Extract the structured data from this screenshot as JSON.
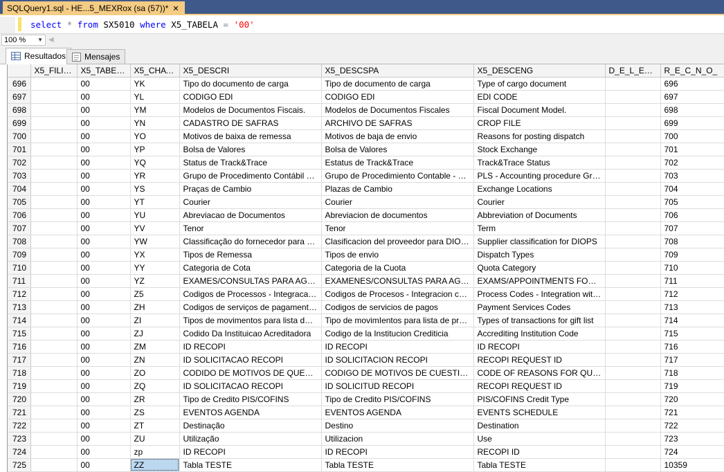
{
  "document_tab": {
    "title": "SQLQuery1.sql - HE...5_MEXRox (sa (57))*",
    "close_glyph": "✕"
  },
  "editor": {
    "tokens": [
      {
        "text": "select",
        "kind": "kw"
      },
      {
        "text": " ",
        "kind": "id"
      },
      {
        "text": "*",
        "kind": "op"
      },
      {
        "text": " ",
        "kind": "id"
      },
      {
        "text": "from",
        "kind": "kw"
      },
      {
        "text": " SX5010 ",
        "kind": "id"
      },
      {
        "text": "where",
        "kind": "kw"
      },
      {
        "text": " X5_TABELA ",
        "kind": "id"
      },
      {
        "text": "=",
        "kind": "op"
      },
      {
        "text": " ",
        "kind": "id"
      },
      {
        "text": "'00'",
        "kind": "str"
      }
    ]
  },
  "zoom": {
    "value": "100 %",
    "arrow": "▼",
    "scroll_left": "◀"
  },
  "results_tabs": {
    "results": "Resultados",
    "messages": "Mensajes"
  },
  "grid": {
    "columns": [
      "",
      "X5_FILIAL",
      "X5_TABELA",
      "X5_CHAVE",
      "X5_DESCRI",
      "X5_DESCSPA",
      "X5_DESCENG",
      "D_E_L_E_T_",
      "R_E_C_N_O_"
    ],
    "selected_row_index": 29,
    "selected_col_index": 3,
    "rows": [
      [
        "696",
        "",
        "00",
        "YK",
        "Tipo do documento de carga",
        "Tipo de documento de carga",
        "Type of cargo document",
        "",
        "696"
      ],
      [
        "697",
        "",
        "00",
        "YL",
        "CODIGO EDI",
        "CODIGO EDI",
        "EDI CODE",
        "",
        "697"
      ],
      [
        "698",
        "",
        "00",
        "YM",
        "Modelos de Documentos Fiscais.",
        "Modelos de Documentos Fiscales",
        "Fiscal Document Model.",
        "",
        "698"
      ],
      [
        "699",
        "",
        "00",
        "YN",
        "CADASTRO DE SAFRAS",
        "ARCHIVO DE SAFRAS",
        "CROP FILE",
        "",
        "699"
      ],
      [
        "700",
        "",
        "00",
        "YO",
        "Motivos de baixa de remessa",
        "Motivos de baja de envio",
        "Reasons for posting dispatch",
        "",
        "700"
      ],
      [
        "701",
        "",
        "00",
        "YP",
        "Bolsa de Valores",
        "Bolsa de Valores",
        "Stock Exchange",
        "",
        "701"
      ],
      [
        "702",
        "",
        "00",
        "YQ",
        "Status de Track&Trace",
        "Estatus de Track&Trace",
        "Track&Trace Status",
        "",
        "702"
      ],
      [
        "703",
        "",
        "00",
        "YR",
        "Grupo de Procedimento Contábil - PLS",
        "Grupo de Procedimiento Contable - PLS",
        "PLS - Accounting procedure Group",
        "",
        "703"
      ],
      [
        "704",
        "",
        "00",
        "YS",
        "Praças de Cambio",
        "Plazas de Cambio",
        "Exchange Locations",
        "",
        "704"
      ],
      [
        "705",
        "",
        "00",
        "YT",
        "Courier",
        "Courier",
        "Courier",
        "",
        "705"
      ],
      [
        "706",
        "",
        "00",
        "YU",
        "Abreviacao de Documentos",
        "Abreviacion de documentos",
        "Abbreviation of Documents",
        "",
        "706"
      ],
      [
        "707",
        "",
        "00",
        "YV",
        "Tenor",
        "Tenor",
        "Term",
        "",
        "707"
      ],
      [
        "708",
        "",
        "00",
        "YW",
        "Classificação do fornecedor para DIO...",
        "Clasificacion del proveedor para DIOPS",
        "Supplier classification for DIOPS",
        "",
        "708"
      ],
      [
        "709",
        "",
        "00",
        "YX",
        "Tipos de Remessa",
        "Tipos de envio",
        "Dispatch Types",
        "",
        "709"
      ],
      [
        "710",
        "",
        "00",
        "YY",
        "Categoria de Cota",
        "Categoria de la Cuota",
        "Quota Category",
        "",
        "710"
      ],
      [
        "711",
        "",
        "00",
        "YZ",
        "EXAMES/CONSULTAS PARA AGEN...",
        "EXAMENES/CONSULTAS PARA AGEN...",
        "EXAMS/APPOINTMENTS FOR SC...",
        "",
        "711"
      ],
      [
        "712",
        "",
        "00",
        "Z5",
        "Codigos de Processos - Integracao co...",
        "Codigos de Procesos - Integracion con Fi...",
        "Process Codes - Integration with Fin...",
        "",
        "712"
      ],
      [
        "713",
        "",
        "00",
        "ZH",
        "Codigos de serviços de pagamentos",
        "Codigos de servicios de pagos",
        "Payment Services Codes",
        "",
        "713"
      ],
      [
        "714",
        "",
        "00",
        "ZI",
        "Tipos de movimentos para lista de pre...",
        "Tipo de movimIentos para lista de present...",
        "Types of transactions for gift list",
        "",
        "714"
      ],
      [
        "715",
        "",
        "00",
        "ZJ",
        "Codido Da Instituicao Acreditadora",
        "Codigo de la Institucion Crediticia",
        "Accrediting Institution Code",
        "",
        "715"
      ],
      [
        "716",
        "",
        "00",
        "ZM",
        "ID RECOPI",
        "ID RECOPI",
        "ID RECOPI",
        "",
        "716"
      ],
      [
        "717",
        "",
        "00",
        "ZN",
        "ID SOLICITACAO RECOPI",
        "ID SOLICITACION RECOPI",
        "RECOPI REQUEST ID",
        "",
        "717"
      ],
      [
        "718",
        "",
        "00",
        "ZO",
        "CODIDO DE MOTIVOS DE QUESTIO...",
        "CODIGO DE MOTIVOS DE CUESTIONA...",
        "CODE OF REASONS FOR QUEST...",
        "",
        "718"
      ],
      [
        "719",
        "",
        "00",
        "ZQ",
        "ID SOLICITACAO RECOPI",
        "ID SOLICITUD RECOPI",
        "RECOPI REQUEST ID",
        "",
        "719"
      ],
      [
        "720",
        "",
        "00",
        "ZR",
        "Tipo de Credito PIS/COFINS",
        "Tipo de Credito PIS/COFINS",
        "PIS/COFINS Credit Type",
        "",
        "720"
      ],
      [
        "721",
        "",
        "00",
        "ZS",
        "EVENTOS AGENDA",
        "EVENTOS AGENDA",
        "EVENTS SCHEDULE",
        "",
        "721"
      ],
      [
        "722",
        "",
        "00",
        "ZT",
        "Destinação",
        "Destino",
        "Destination",
        "",
        "722"
      ],
      [
        "723",
        "",
        "00",
        "ZU",
        "Utilização",
        "Utilizacion",
        "Use",
        "",
        "723"
      ],
      [
        "724",
        "",
        "00",
        "zp",
        "ID RECOPI",
        "ID RECOPI",
        "RECOPI ID",
        "",
        "724"
      ],
      [
        "725",
        "",
        "00",
        "ZZ",
        "Tabla TESTE",
        "Tabla TESTE",
        "Tabla TESTE",
        "",
        "10359"
      ]
    ]
  }
}
